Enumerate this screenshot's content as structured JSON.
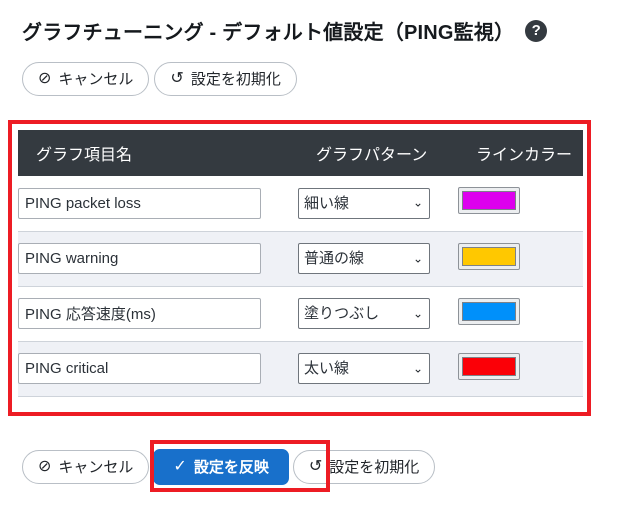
{
  "header": {
    "title": "グラフチューニング - デフォルト値設定（PING監視）",
    "help_icon": "help-circle-icon",
    "help_glyph": "?"
  },
  "toolbar_top": {
    "cancel": {
      "label": "キャンセル",
      "icon": "no-entry-icon",
      "glyph": "⊘"
    },
    "reset": {
      "label": "設定を初期化",
      "icon": "undo-arrow-icon",
      "glyph": "↺"
    }
  },
  "table": {
    "headers": {
      "name": "グラフ項目名",
      "pattern": "グラフパターン",
      "color": "ラインカラー"
    },
    "pattern_options": [
      "細い線",
      "普通の線",
      "太い線",
      "塗りつぶし"
    ],
    "rows": [
      {
        "name": "PING packet loss",
        "pattern": "細い線",
        "color": "#dd00ee"
      },
      {
        "name": "PING warning",
        "pattern": "普通の線",
        "color": "#ffc800"
      },
      {
        "name": "PING 応答速度(ms)",
        "pattern": "塗りつぶし",
        "color": "#0090fa"
      },
      {
        "name": "PING critical",
        "pattern": "太い線",
        "color": "#fb0007"
      }
    ]
  },
  "toolbar_bottom": {
    "cancel": {
      "label": "キャンセル",
      "icon": "no-entry-icon",
      "glyph": "⊘"
    },
    "apply": {
      "label": "設定を反映",
      "icon": "check-icon",
      "glyph": "✓"
    },
    "reset": {
      "label": "設定を初期化",
      "icon": "undo-arrow-icon",
      "glyph": "↺"
    }
  },
  "annotations": {
    "accent_color": "#ed1c24",
    "table_highlight": "table-highlight-box",
    "apply_highlight": "apply-button-highlight-box"
  }
}
